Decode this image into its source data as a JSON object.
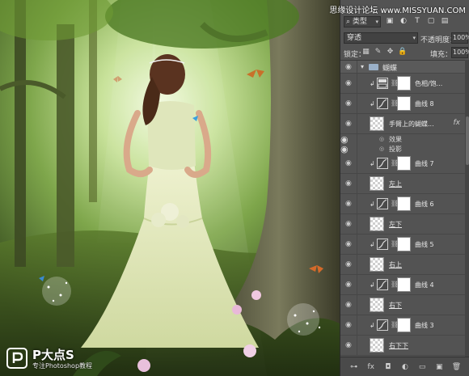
{
  "watermark": "思缘设计论坛 www.MISSYUAN.COM",
  "logo": {
    "title": "P大点S",
    "subtitle": "专注Photoshop教程"
  },
  "panel": {
    "filter": {
      "kind_label": "类型",
      "icons": [
        "image-filter-icon",
        "adjustment-filter-icon",
        "text-filter-icon",
        "shape-filter-icon",
        "smart-object-filter-icon"
      ]
    },
    "blend_mode": "穿透",
    "opacity_label": "不透明度：",
    "opacity_value": "100%",
    "lock_label": "锁定：",
    "fill_label": "填充：",
    "fill_value": "100%",
    "group": {
      "name": "蝴蝶",
      "expanded": true
    },
    "layers": [
      {
        "kind": "adjustment",
        "adjust": "hue",
        "name": "色相/饱...",
        "clipped": true
      },
      {
        "kind": "adjustment",
        "adjust": "curves",
        "name": "曲线 8",
        "clipped": true
      },
      {
        "kind": "pixel",
        "name": "手臂上的蝴蝶...",
        "has_fx": true,
        "fx_label": "fx"
      },
      {
        "kind": "effect",
        "name": "效果"
      },
      {
        "kind": "effect",
        "name": "投影"
      },
      {
        "kind": "adjustment",
        "adjust": "curves",
        "name": "曲线 7",
        "clipped": true
      },
      {
        "kind": "pixel",
        "name": "左上"
      },
      {
        "kind": "adjustment",
        "adjust": "curves",
        "name": "曲线 6",
        "clipped": true
      },
      {
        "kind": "pixel",
        "name": "左下"
      },
      {
        "kind": "adjustment",
        "adjust": "curves",
        "name": "曲线 5",
        "clipped": true
      },
      {
        "kind": "pixel",
        "name": "右上"
      },
      {
        "kind": "adjustment",
        "adjust": "curves",
        "name": "曲线 4",
        "clipped": true
      },
      {
        "kind": "pixel",
        "name": "右下"
      },
      {
        "kind": "adjustment",
        "adjust": "curves",
        "name": "曲线 3",
        "clipped": true
      },
      {
        "kind": "pixel",
        "name": "右下下"
      }
    ],
    "footer_icons": [
      "link-layers-icon",
      "fx-icon",
      "add-mask-icon",
      "new-adjustment-icon",
      "new-group-icon",
      "new-layer-icon",
      "delete-layer-icon"
    ],
    "footer_glyphs": [
      "⊶",
      "fx",
      "◘",
      "◐",
      "▭",
      "▣",
      "🗑"
    ]
  },
  "colors": {
    "panel_bg": "#535353",
    "forest_light": "#b9d98a",
    "dress": "#e4eac0"
  }
}
